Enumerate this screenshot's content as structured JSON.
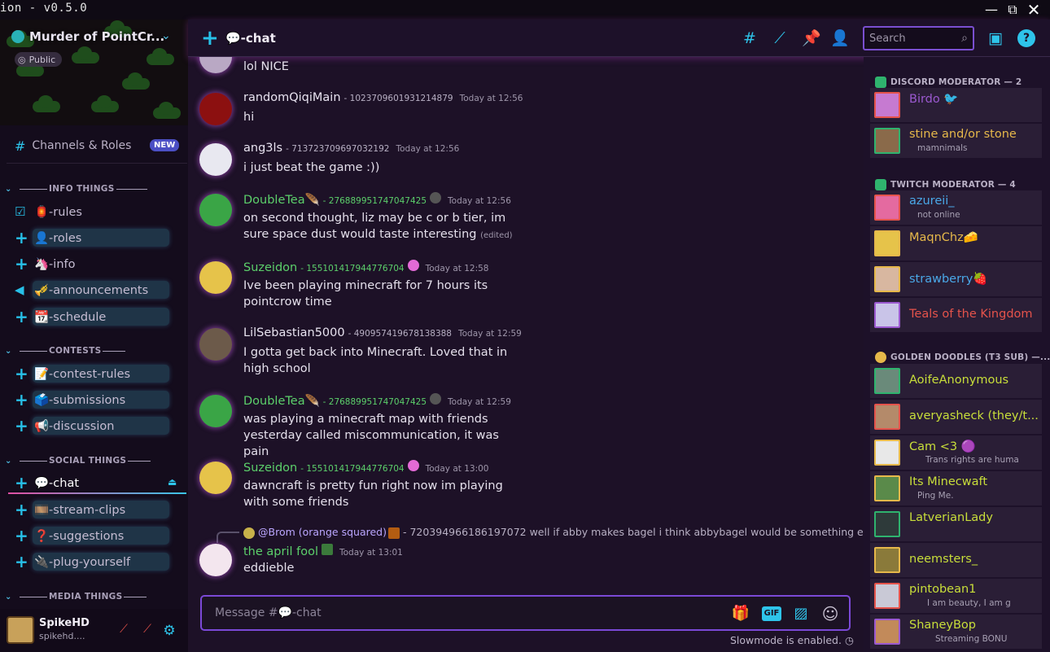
{
  "window": {
    "title": "ion - v0.5.0"
  },
  "server": {
    "name": "Murder of PointCr...",
    "visibility": "Public",
    "channels_roles_label": "Channels & Roles",
    "new_badge": "NEW"
  },
  "categories": {
    "info": "INFO THINGS",
    "contests": "CONTESTS",
    "social": "SOCIAL THINGS",
    "media": "MEDIA THINGS"
  },
  "channels": [
    {
      "label": "🏮-rules"
    },
    {
      "label": "👤-roles"
    },
    {
      "label": "🦄-info"
    },
    {
      "label": "🎺-announcements"
    },
    {
      "label": "📆-schedule"
    },
    {
      "label": "📝-contest-rules"
    },
    {
      "label": "🗳️-submissions"
    },
    {
      "label": "📢-discussion"
    },
    {
      "label": "💬-chat"
    },
    {
      "label": "🎞️-stream-clips"
    },
    {
      "label": "❓-suggestions"
    },
    {
      "label": "🔌-plug-yourself"
    }
  ],
  "user": {
    "name": "SpikeHD",
    "status": "spikehd...."
  },
  "header": {
    "channel": "💬-chat",
    "search_placeholder": "Search"
  },
  "messages": [
    {
      "author": "",
      "id": "",
      "time": "",
      "lines": [
        "lol NICE"
      ]
    },
    {
      "author": "randomQiqiMain",
      "id": "- 1023709601931214879",
      "time": "Today at 12:56",
      "lines": [
        "hi"
      ]
    },
    {
      "author": "ang3ls",
      "id": "- 713723709697032192",
      "time": "Today at 12:56",
      "lines": [
        "i just beat the game :))"
      ]
    },
    {
      "author": "DoubleTea🪶",
      "id": "- 276889951747047425",
      "time": "Today at 12:56",
      "lines": [
        "on second thought, liz may be c or b tier, im",
        "sure space dust would taste interesting"
      ],
      "edited": "(edited)"
    },
    {
      "author": "Suzeidon",
      "id": "- 155101417944776704",
      "time": "Today at 12:58",
      "lines": [
        "Ive been playing minecraft for 7 hours its",
        "pointcrow time"
      ]
    },
    {
      "author": "LilSebastian5000",
      "id": "- 490957419678138388",
      "time": "Today at 12:59",
      "lines": [
        "I gotta get back into Minecraft. Loved that in",
        "high school"
      ]
    },
    {
      "author": "DoubleTea🪶",
      "id": "- 276889951747047425",
      "time": "Today at 12:59",
      "lines": [
        "was playing a minecraft map with friends",
        "yesterday called miscommunication, it was pain"
      ]
    },
    {
      "author": "Suzeidon",
      "id": "- 155101417944776704",
      "time": "Today at 13:00",
      "lines": [
        "dawncraft is pretty fun right now im playing",
        "with some friends"
      ]
    },
    {
      "author": "the april fool",
      "id": "",
      "time": "Today at 13:01",
      "lines": [
        "eddieble"
      ]
    }
  ],
  "reply": {
    "name": "@Brom (orange squared)",
    "rest": "- 720394966186197072 well if abby makes bagel i think abbybagel would be something edi..."
  },
  "composer": {
    "placeholder": "Message #💬-chat",
    "gif": "GIF",
    "slowmode": "Slowmode is enabled."
  },
  "member_groups": [
    {
      "title": "DISCORD MODERATOR — 2",
      "color": "#2fb36e"
    },
    {
      "title": "TWITCH MODERATOR — 4",
      "color": "#2fb36e"
    },
    {
      "title": "GOLDEN DOODLES (T3 SUB) —...",
      "color": "#e6b84a"
    }
  ],
  "members": [
    {
      "name": "Birdo 🐦",
      "status": "",
      "color": "#9b59d0"
    },
    {
      "name": "stine and/or stone",
      "status": "mamnimals",
      "color": "#e6b84a"
    },
    {
      "name": "azureii_",
      "status": "not online",
      "color": "#4aa8e8"
    },
    {
      "name": "MaqnChz🧀",
      "status": "",
      "color": "#e6b84a"
    },
    {
      "name": "strawberry🍓",
      "status": "",
      "color": "#4aa8e8"
    },
    {
      "name": "Teals of the Kingdom",
      "status": "",
      "color": "#e5534b"
    },
    {
      "name": "AoifeAnonymous",
      "status": "",
      "color": "#c8de3a"
    },
    {
      "name": "averyasheck (they/t...",
      "status": "",
      "color": "#c8de3a"
    },
    {
      "name": "Cam <3 🟣",
      "status": "Trans rights are huma",
      "color": "#c8de3a"
    },
    {
      "name": "Its Minecwaft",
      "status": "Ping Me.",
      "color": "#c8de3a"
    },
    {
      "name": "LatverianLady",
      "status": "",
      "color": "#c8de3a"
    },
    {
      "name": "neemsters_",
      "status": "",
      "color": "#c8de3a"
    },
    {
      "name": "pintobean1",
      "status": "I am beauty, I am g",
      "color": "#c8de3a"
    },
    {
      "name": "ShaneyBop",
      "status": "Streaming BONU",
      "color": "#c8de3a"
    }
  ],
  "colors": {
    "accent_cyan": "#2ec4ea",
    "accent_purple": "#7b49d6",
    "author_green": "#5cd06b"
  }
}
